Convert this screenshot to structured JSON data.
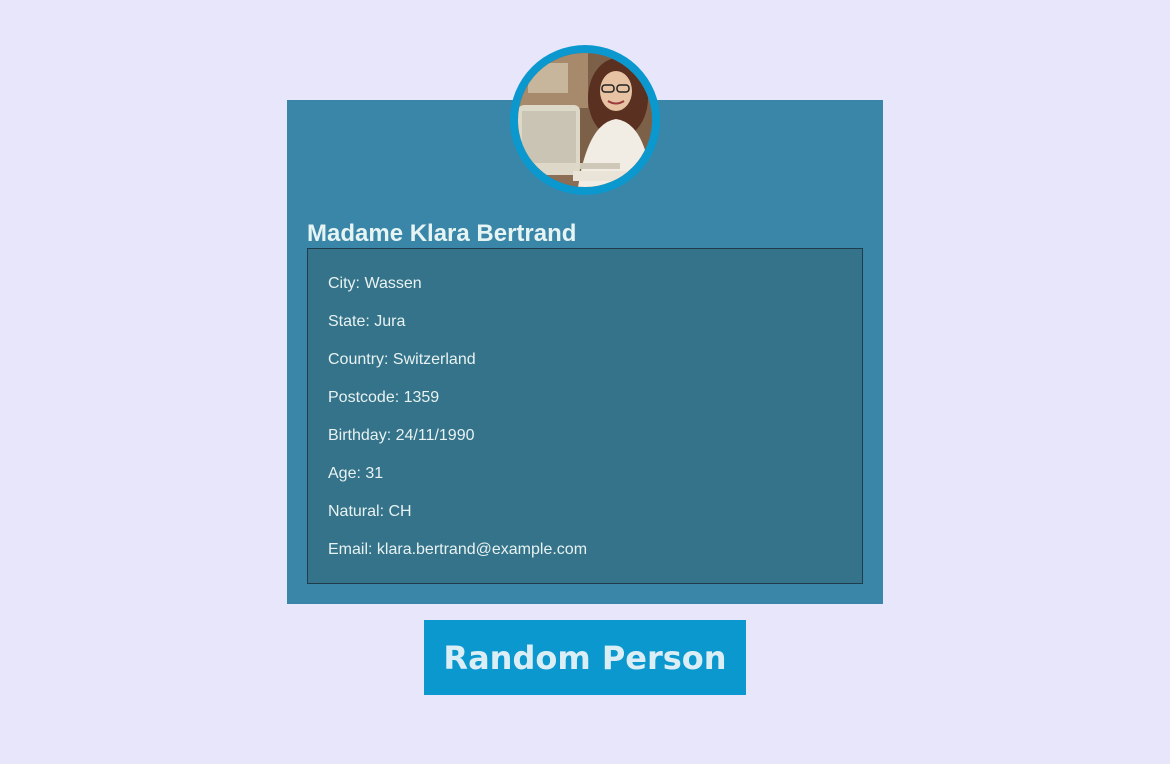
{
  "profile": {
    "name": "Madame Klara Bertrand",
    "details": [
      {
        "label": "City:",
        "value": "Wassen"
      },
      {
        "label": "State:",
        "value": "Jura"
      },
      {
        "label": "Country:",
        "value": "Switzerland"
      },
      {
        "label": "Postcode:",
        "value": "1359"
      },
      {
        "label": "Birthday:",
        "value": "24/11/1990"
      },
      {
        "label": "Age:",
        "value": "31"
      },
      {
        "label": "Natural:",
        "value": "CH"
      },
      {
        "label": "Email:",
        "value": "klara.bertrand@example.com"
      }
    ]
  },
  "actions": {
    "random_label": "Random Person"
  },
  "colors": {
    "page_bg": "#e8e6fb",
    "card_bg": "#3986a8",
    "details_bg": "#347389",
    "accent": "#0a98cf"
  }
}
